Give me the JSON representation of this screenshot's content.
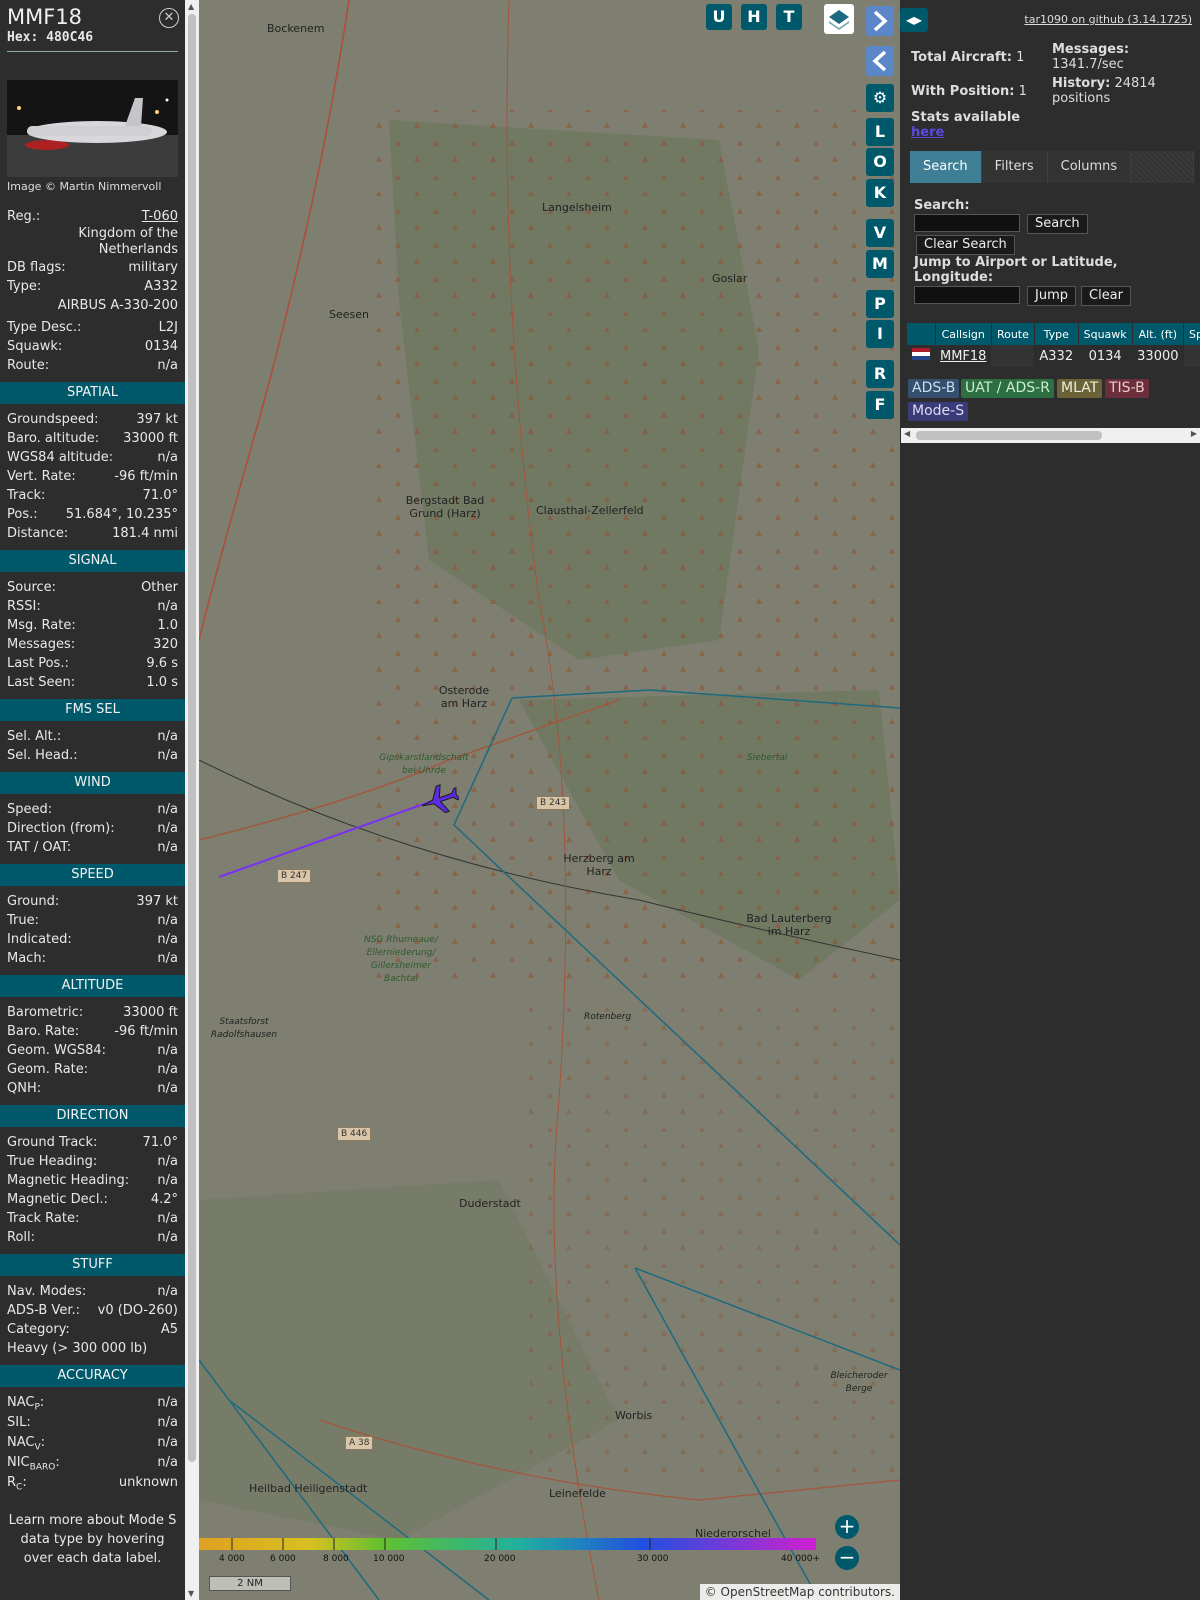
{
  "info": {
    "callsign": "MMF18",
    "hex_label": "Hex:",
    "hex": "480C46",
    "photo_credit": "Image © Martin Nimmervoll",
    "reg_label": "Reg.:",
    "reg": "T-060",
    "country": "Kingdom of the Netherlands",
    "dbflags_label": "DB flags:",
    "dbflags": "military",
    "type_label": "Type:",
    "type": "A332",
    "type_full": "AIRBUS A-330-200",
    "typedesc_label": "Type Desc.:",
    "typedesc": "L2J",
    "squawk_label": "Squawk:",
    "squawk": "0134",
    "route_label": "Route:",
    "route": "n/a"
  },
  "sections": {
    "spatial": "SPATIAL",
    "signal": "SIGNAL",
    "fms": "FMS SEL",
    "wind": "WIND",
    "speed": "SPEED",
    "altitude": "ALTITUDE",
    "direction": "DIRECTION",
    "stuff": "STUFF",
    "accuracy": "ACCURACY"
  },
  "spatial": [
    {
      "label": "Groundspeed:",
      "value": "397 kt"
    },
    {
      "label": "Baro. altitude:",
      "value": "33000 ft"
    },
    {
      "label": "WGS84 altitude:",
      "value": "n/a"
    },
    {
      "label": "Vert. Rate:",
      "value": "-96 ft/min"
    },
    {
      "label": "Track:",
      "value": "71.0°"
    },
    {
      "label": "Pos.:",
      "value": "51.684°, 10.235°"
    },
    {
      "label": "Distance:",
      "value": "181.4 nmi"
    }
  ],
  "signal": [
    {
      "label": "Source:",
      "value": "Other"
    },
    {
      "label": "RSSI:",
      "value": "n/a"
    },
    {
      "label": "Msg. Rate:",
      "value": "1.0"
    },
    {
      "label": "Messages:",
      "value": "320"
    },
    {
      "label": "Last Pos.:",
      "value": "9.6 s"
    },
    {
      "label": "Last Seen:",
      "value": "1.0 s"
    }
  ],
  "fms": [
    {
      "label": "Sel. Alt.:",
      "value": "n/a"
    },
    {
      "label": "Sel. Head.:",
      "value": "n/a"
    }
  ],
  "wind": [
    {
      "label": "Speed:",
      "value": "n/a"
    },
    {
      "label": "Direction (from):",
      "value": "n/a"
    },
    {
      "label": "TAT / OAT:",
      "value": "n/a"
    }
  ],
  "speed": [
    {
      "label": "Ground:",
      "value": "397 kt"
    },
    {
      "label": "True:",
      "value": "n/a"
    },
    {
      "label": "Indicated:",
      "value": "n/a"
    },
    {
      "label": "Mach:",
      "value": "n/a"
    }
  ],
  "altitude": [
    {
      "label": "Barometric:",
      "value": "33000 ft"
    },
    {
      "label": "Baro. Rate:",
      "value": "-96 ft/min"
    },
    {
      "label": "Geom. WGS84:",
      "value": "n/a"
    },
    {
      "label": "Geom. Rate:",
      "value": "n/a"
    },
    {
      "label": "QNH:",
      "value": "n/a"
    }
  ],
  "direction": [
    {
      "label": "Ground Track:",
      "value": "71.0°"
    },
    {
      "label": "True Heading:",
      "value": "n/a"
    },
    {
      "label": "Magnetic Heading:",
      "value": "n/a"
    },
    {
      "label": "Magnetic Decl.:",
      "value": "4.2°"
    },
    {
      "label": "Track Rate:",
      "value": "n/a"
    },
    {
      "label": "Roll:",
      "value": "n/a"
    }
  ],
  "stuff": [
    {
      "label": "Nav. Modes:",
      "value": "n/a"
    },
    {
      "label": "ADS-B Ver.:",
      "value": "v0 (DO-260)"
    },
    {
      "label": "Category:",
      "value": "A5"
    }
  ],
  "stuff_category_desc": "Heavy (> 300 000 lb)",
  "accuracy": [
    {
      "label": "NAC",
      "sub": "P",
      "suffix": ":",
      "value": "n/a"
    },
    {
      "label": "SIL:",
      "sub": "",
      "suffix": "",
      "value": "n/a"
    },
    {
      "label": "NAC",
      "sub": "V",
      "suffix": ":",
      "value": "n/a"
    },
    {
      "label": "NIC",
      "sub": "BARO",
      "suffix": ":",
      "value": "n/a"
    },
    {
      "label": "R",
      "sub": "C",
      "suffix": ":",
      "value": "unknown"
    }
  ],
  "footer_note": "Learn more about Mode S data type by hovering over each data label.",
  "map": {
    "top_buttons": [
      "U",
      "H",
      "T"
    ],
    "side_buttons": [
      "L",
      "O",
      "K",
      "V",
      "M",
      "P",
      "I",
      "R",
      "F"
    ],
    "places": [
      "Bockenem",
      "Langelsheim",
      "Goslar",
      "Seesen",
      "Bergstadt Bad Grund (Harz)",
      "Clausthal-Zellerfeld",
      "Osterode am Harz",
      "Gipskarstlandschaft bei Uhrde",
      "Herzberg am Harz",
      "Bad Lauterberg im Harz",
      "Siebertal",
      "NSG Rhumeaue/ Ellerniederung/ Gillersheimer Bachtal",
      "Staatsforst Radolfshausen",
      "Rotenberg",
      "Duderstadt",
      "Worbis",
      "Leinefelde",
      "Heilbad Heiligenstadt",
      "Niederorschel",
      "Bleicheroder Berge"
    ],
    "roads": [
      "B 243",
      "B 247",
      "B 446",
      "A 38"
    ],
    "altitude_ticks": [
      "4 000",
      "6 000",
      "8 000",
      "10 000",
      "20 000",
      "30 000",
      "40 000+"
    ],
    "scale": "2 NM",
    "attribution_prefix": "© ",
    "attribution_link": "OpenStreetMap",
    "attribution_suffix": " contributors."
  },
  "sidebar": {
    "github": "tar1090 on github (3.14.1725)",
    "total_aircraft_label": "Total Aircraft:",
    "total_aircraft": "1",
    "with_position_label": "With Position:",
    "with_position": "1",
    "messages_label": "Messages:",
    "messages": "1341.7/sec",
    "history_label": "History:",
    "history": "24814 positions",
    "stats_label": "Stats available",
    "stats_link": "here",
    "tabs": [
      "Search",
      "Filters",
      "Columns"
    ],
    "search_label": "Search:",
    "search_button": "Search",
    "clear_search_button": "Clear Search",
    "jump_label": "Jump to Airport or Latitude, Longitude:",
    "jump_button": "Jump",
    "clear_button": "Clear",
    "columns": [
      "",
      "Callsign",
      "Route",
      "Type",
      "Squawk",
      "Alt. (ft)",
      "Spd."
    ],
    "rows": [
      {
        "callsign": "MMF18",
        "route": "",
        "type": "A332",
        "squawk": "0134",
        "alt": "33000",
        "spd": ""
      }
    ],
    "sources": [
      "ADS-B",
      "UAT / ADS-R",
      "MLAT",
      "TIS-B",
      "Mode-S"
    ]
  },
  "colors": {
    "accent": "#00596b",
    "track": "#7b2ff7",
    "aircraft": "#5b2ce0",
    "adsb": "#35506f",
    "uat": "#2e6e43",
    "mlat": "#6b6238",
    "tisb": "#6b2e3a",
    "modes": "#3b3b7a"
  }
}
